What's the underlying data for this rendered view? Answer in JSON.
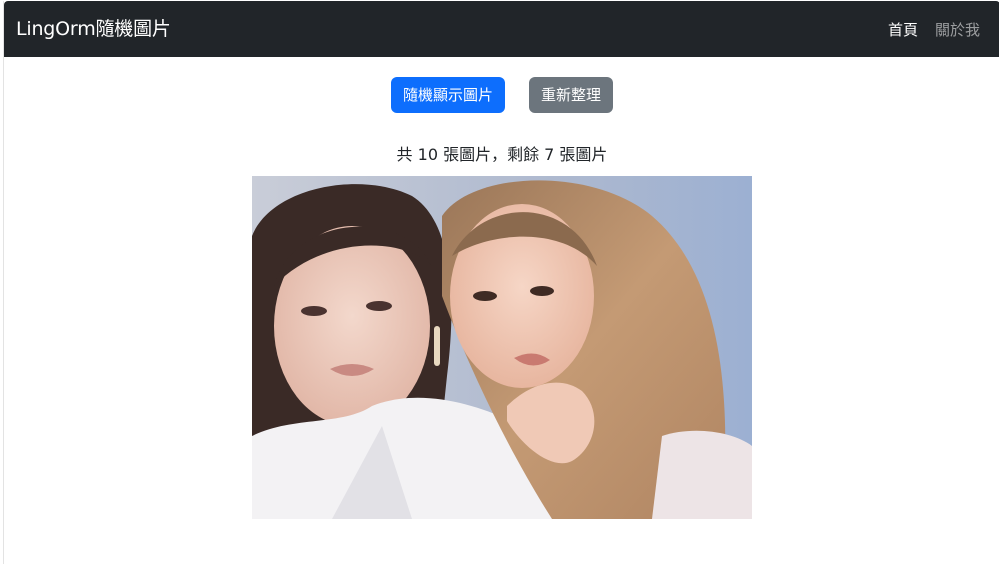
{
  "navbar": {
    "brand": "LingOrm隨機圖片",
    "links": [
      {
        "label": "首頁",
        "active": true
      },
      {
        "label": "關於我",
        "active": false
      }
    ]
  },
  "controls": {
    "random_button": "隨機顯示圖片",
    "reset_button": "重新整理"
  },
  "status": {
    "count_text": "共 10 張圖片，剩餘 7 張圖片"
  },
  "colors": {
    "navbar_bg": "#212529",
    "primary": "#0d6efd",
    "secondary": "#6c757d"
  }
}
